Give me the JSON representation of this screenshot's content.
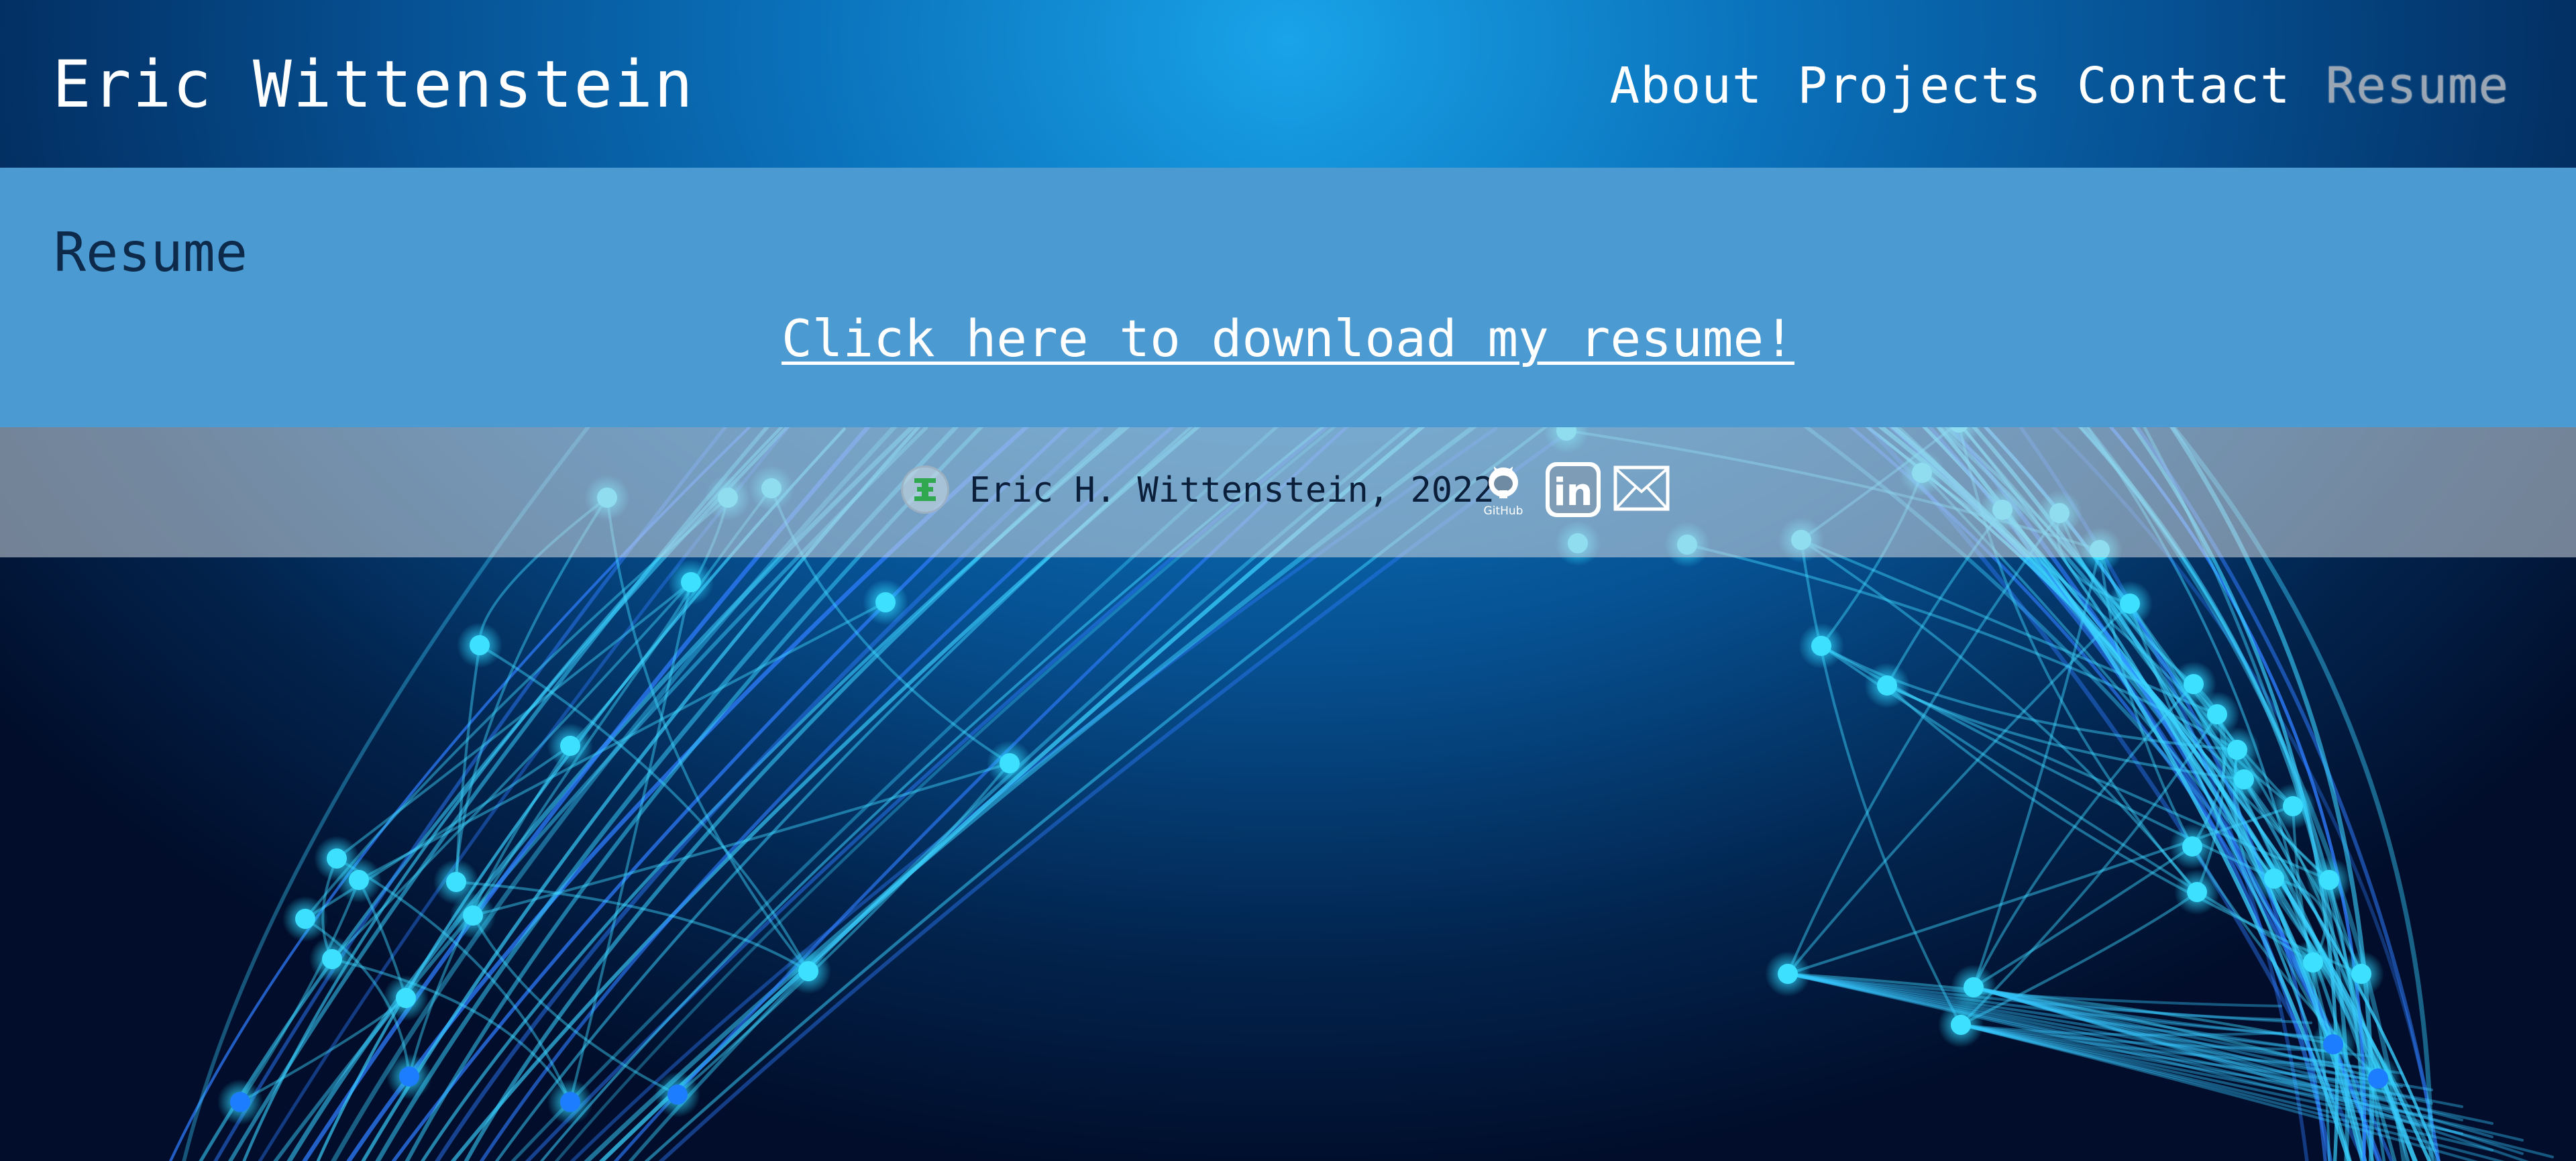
{
  "header": {
    "site_title": "Eric Wittenstein",
    "nav": [
      {
        "label": "About"
      },
      {
        "label": "Projects"
      },
      {
        "label": "Contact"
      },
      {
        "label": "Resume",
        "active": true
      }
    ]
  },
  "main": {
    "heading": "Resume",
    "download_link": "Click here to download my resume!"
  },
  "footer": {
    "logo_icon": "eh-logo-icon",
    "text": "Eric H. Wittenstein, 2022",
    "social": [
      {
        "icon": "github-icon",
        "label": "GitHub"
      },
      {
        "icon": "linkedin-icon",
        "label": "in"
      },
      {
        "icon": "mail-icon"
      }
    ]
  },
  "colors": {
    "background_top": "#1aa4e8",
    "background_bottom": "#010d2a",
    "panel": "#4b9ad2",
    "footer": "#d2dae2",
    "network_line": "#35d4ff",
    "active_nav": "#9aa6b4"
  }
}
